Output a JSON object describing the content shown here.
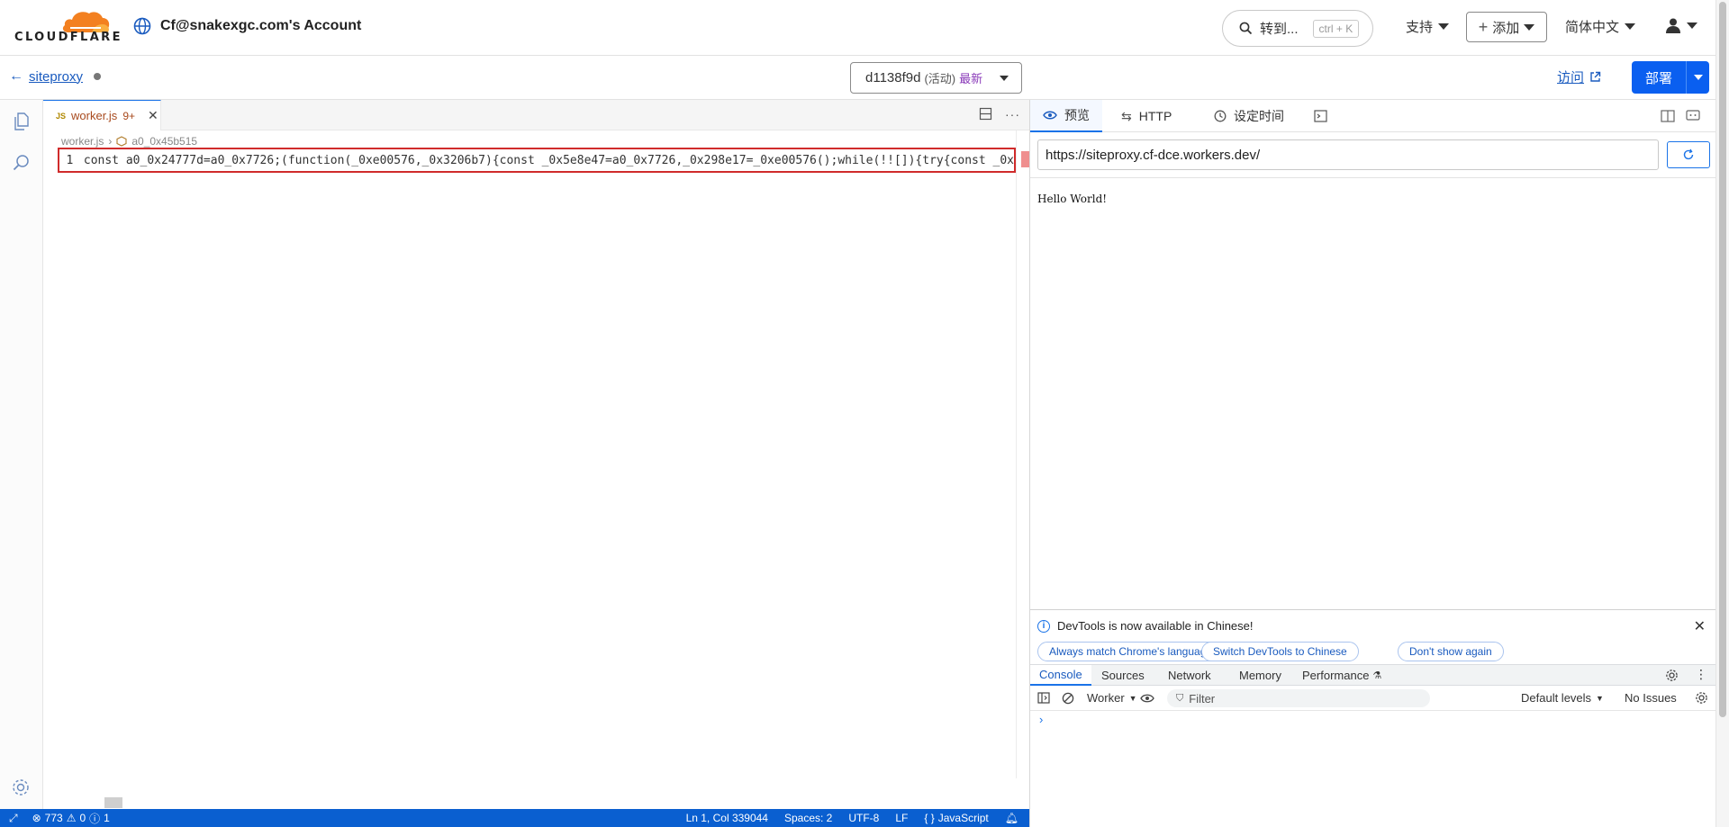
{
  "header": {
    "logo_text": "CLOUDFLARE",
    "account": "Cf@snakexgc.com's Account",
    "search_label": "转到...",
    "search_shortcut": "ctrl + K",
    "support": "支持",
    "add": "添加",
    "language": "简体中文"
  },
  "subbar": {
    "worker_name": "siteproxy",
    "version_id": "d1138f9d",
    "version_status": "(活动)",
    "version_latest": "最新",
    "visit": "访问",
    "deploy": "部署"
  },
  "editor": {
    "tab_file": "worker.js",
    "tab_problems": "9+",
    "breadcrumb_file": "worker.js",
    "breadcrumb_symbol": "a0_0x45b515",
    "line_number": "1",
    "code": "const a0_0x24777d=a0_0x7726;(function(_0xe00576,_0x3206b7){const _0x5e8e47=a0_0x7726,_0x298e17=_0xe00576();while(!![]){try{const _0x"
  },
  "statusbar": {
    "errors": "773",
    "warnings": "0",
    "infos": "1",
    "position": "Ln 1, Col 339044",
    "spaces": "Spaces: 2",
    "encoding": "UTF-8",
    "eol": "LF",
    "language": "JavaScript"
  },
  "preview": {
    "tabs": [
      "预览",
      "HTTP",
      "设定时间"
    ],
    "url": "https://siteproxy.cf-dce.workers.dev/",
    "body": "Hello World!"
  },
  "devtools": {
    "notice": "DevTools is now available in Chinese!",
    "btn_match": "Always match Chrome's language",
    "btn_switch": "Switch DevTools to Chinese",
    "btn_dismiss": "Don't show again",
    "tabs": [
      "Console",
      "Sources",
      "Network",
      "Memory",
      "Performance"
    ],
    "context": "Worker",
    "filter_placeholder": "Filter",
    "levels": "Default levels",
    "issues": "No Issues"
  },
  "colors": {
    "accent": "#0a5ff0",
    "cloudflare_orange": "#f38020",
    "error_border": "#d02b2b",
    "statusbar": "#0a5fd0"
  }
}
